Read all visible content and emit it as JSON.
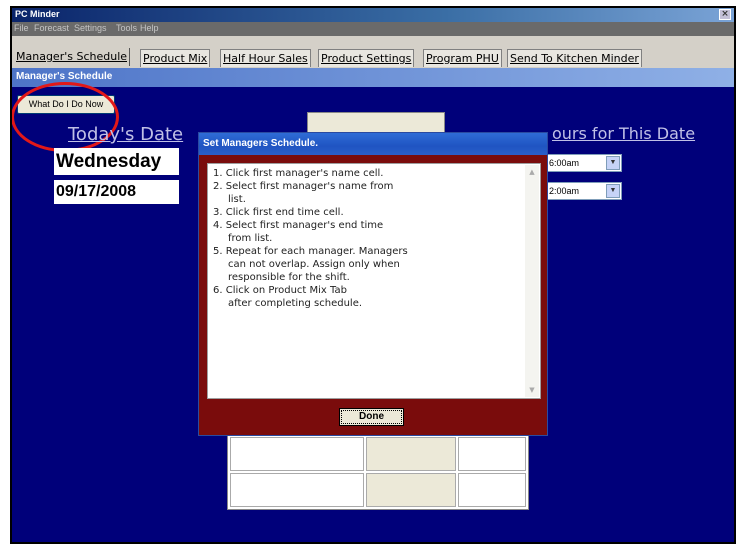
{
  "window": {
    "title": "PC Minder",
    "close_glyph": "×"
  },
  "menu": [
    "File",
    "Forecast",
    "Settings",
    "Tools",
    "Help"
  ],
  "tabs": [
    "Manager's Schedule",
    "Product Mix",
    "Half Hour Sales",
    "Product Settings",
    "Program PHU",
    "Send To Kitchen Minder"
  ],
  "section_header": "Manager's Schedule",
  "what_do_i_do_button": "What Do I Do Now",
  "todays_date_label": "Today's Date",
  "weekday": "Wednesday",
  "date_value": "09/17/2008",
  "hours_label": "ours for This Date",
  "time_selects": [
    "6:00am",
    "2:00am"
  ],
  "dialog": {
    "title": "Set Managers Schedule.",
    "steps": [
      "1. Click first manager's name cell.",
      "2. Select first manager's name from",
      "list.",
      "3. Click first end time cell.",
      "4. Select first manager's end time",
      "from list.",
      "5. Repeat for each manager. Managers",
      "can not overlap. Assign only when",
      "responsible for the shift.",
      "6. Click on Product Mix Tab",
      "after completing schedule."
    ],
    "done_button": "Done"
  },
  "colors": {
    "background": "#00007a",
    "dialog_frame": "#7a0c0c",
    "highlight": "#e21818"
  },
  "icons": {
    "close": "close-icon",
    "dropdown": "chevron-down-icon",
    "scroll_up": "scroll-up-icon",
    "scroll_down": "scroll-down-icon"
  }
}
